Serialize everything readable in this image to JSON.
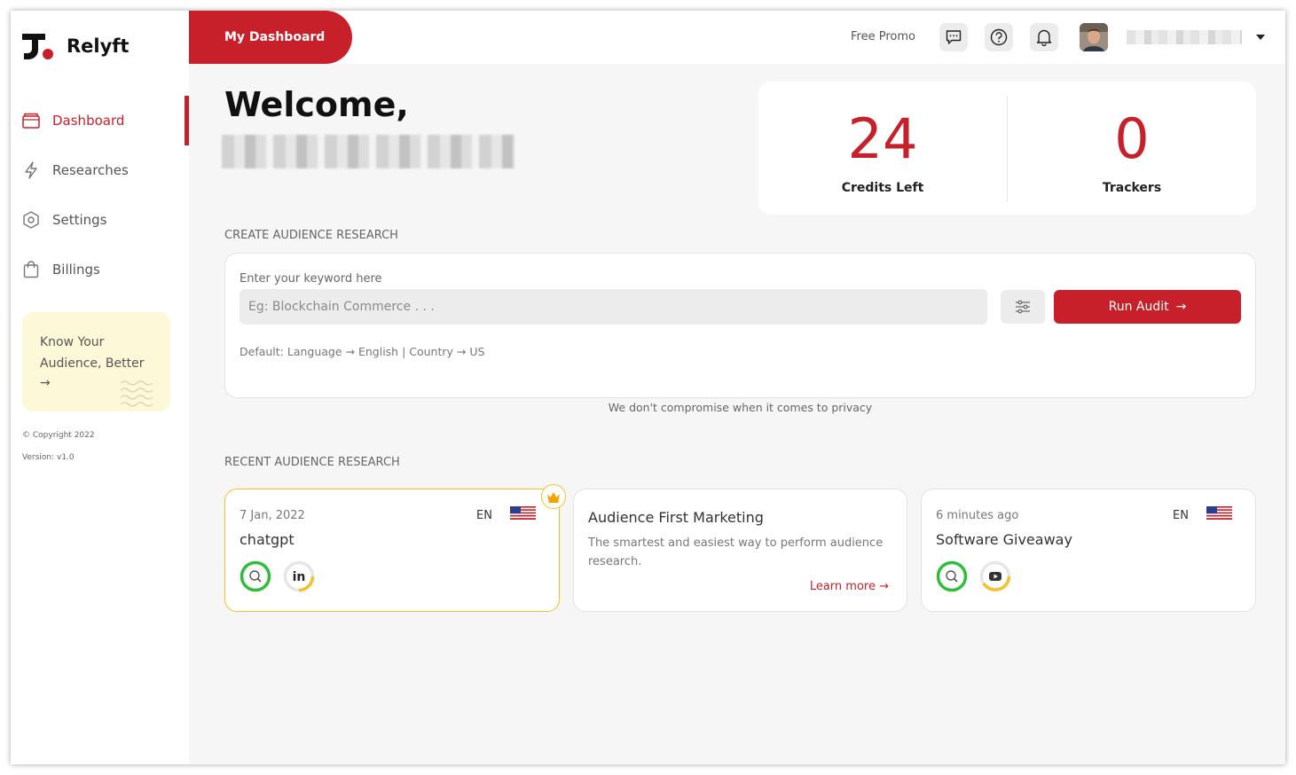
{
  "app": {
    "name": "Relyft"
  },
  "sidebar": {
    "items": [
      {
        "label": "Dashboard",
        "icon": "folder-icon",
        "active": true
      },
      {
        "label": "Researches",
        "icon": "lightning-icon"
      },
      {
        "label": "Settings",
        "icon": "hexagon-gear-icon"
      },
      {
        "label": "Billings",
        "icon": "shopping-bag-icon"
      }
    ],
    "promo": {
      "text": "Know Your Audience, Better",
      "arrow": "→"
    },
    "copyright": "© Copyright 2022",
    "version": "Version: v1.0"
  },
  "topbar": {
    "tab_label": "My Dashboard",
    "free_promo": "Free Promo",
    "icons": [
      "chat-icon",
      "help-icon",
      "bell-icon"
    ]
  },
  "welcome": {
    "greeting": "Welcome,"
  },
  "stats": [
    {
      "value": "24",
      "label": "Credits Left"
    },
    {
      "value": "0",
      "label": "Trackers"
    }
  ],
  "create": {
    "section_title": "CREATE AUDIENCE RESEARCH",
    "input_label": "Enter your keyword here",
    "input_placeholder": "Eg: Blockchain Commerce . . .",
    "run_label": "Run Audit",
    "run_arrow": "→",
    "defaults": "Default: Language → English | Country → US",
    "privacy": "We don't compromise when it comes to privacy"
  },
  "recent": {
    "section_title": "RECENT AUDIENCE RESEARCH",
    "cards": [
      {
        "date": "7 Jan, 2022",
        "lang": "EN",
        "title": "chatgpt",
        "featured": true
      },
      {
        "title": "Audience First Marketing",
        "desc": "The smartest and easiest way to perform audience research.",
        "link": "Learn more →"
      },
      {
        "date": "6 minutes ago",
        "lang": "EN",
        "title": "Software Giveaway"
      }
    ]
  },
  "colors": {
    "accent": "#c8202a",
    "promo_bg": "#fdf8d8",
    "ring_green": "#2dbf3a",
    "ring_yellow": "#f5c12b"
  }
}
